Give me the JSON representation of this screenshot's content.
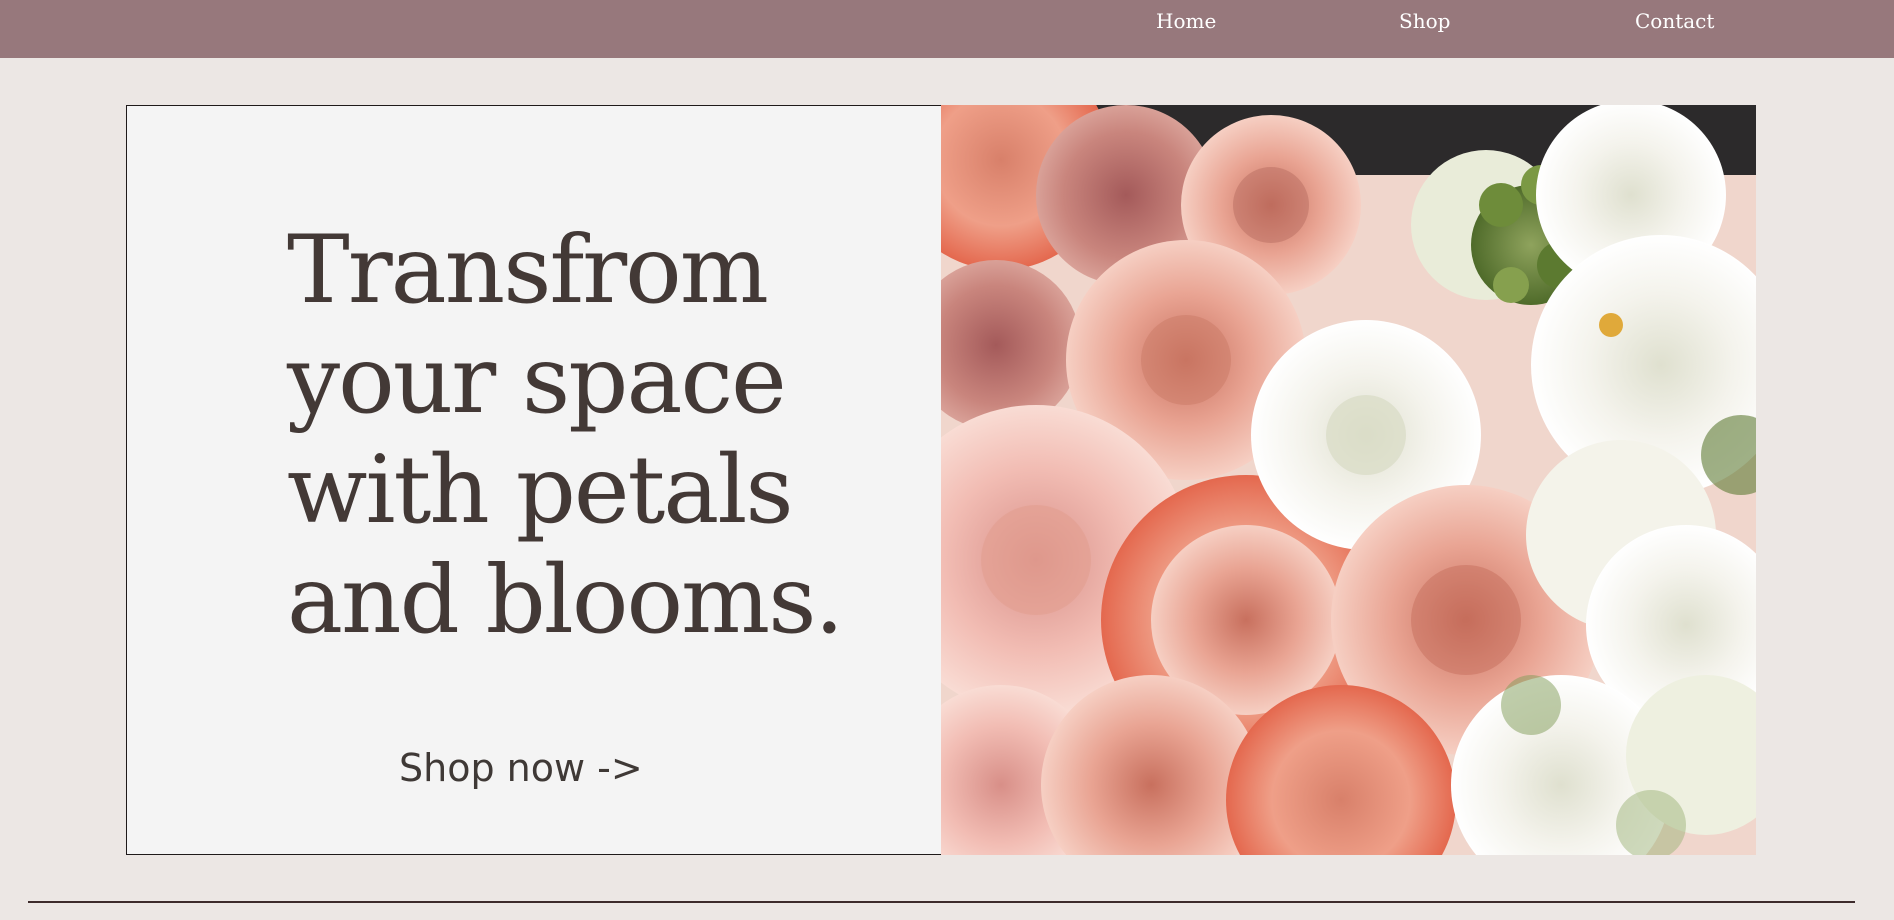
{
  "nav": {
    "links": [
      {
        "label": "Home"
      },
      {
        "label": "Shop"
      },
      {
        "label": "Contact"
      }
    ]
  },
  "hero": {
    "headline_lines": [
      "Transfrom",
      "your space",
      "with petals",
      "and blooms."
    ],
    "cta_label": "Shop now ->"
  },
  "colors": {
    "nav_background": "#97787c",
    "page_background": "#ece7e4",
    "card_background": "#f4f4f4",
    "headline_text": "#433936",
    "divider": "#3d2b2b"
  },
  "image": {
    "subject": "flower-bouquet-photo"
  }
}
